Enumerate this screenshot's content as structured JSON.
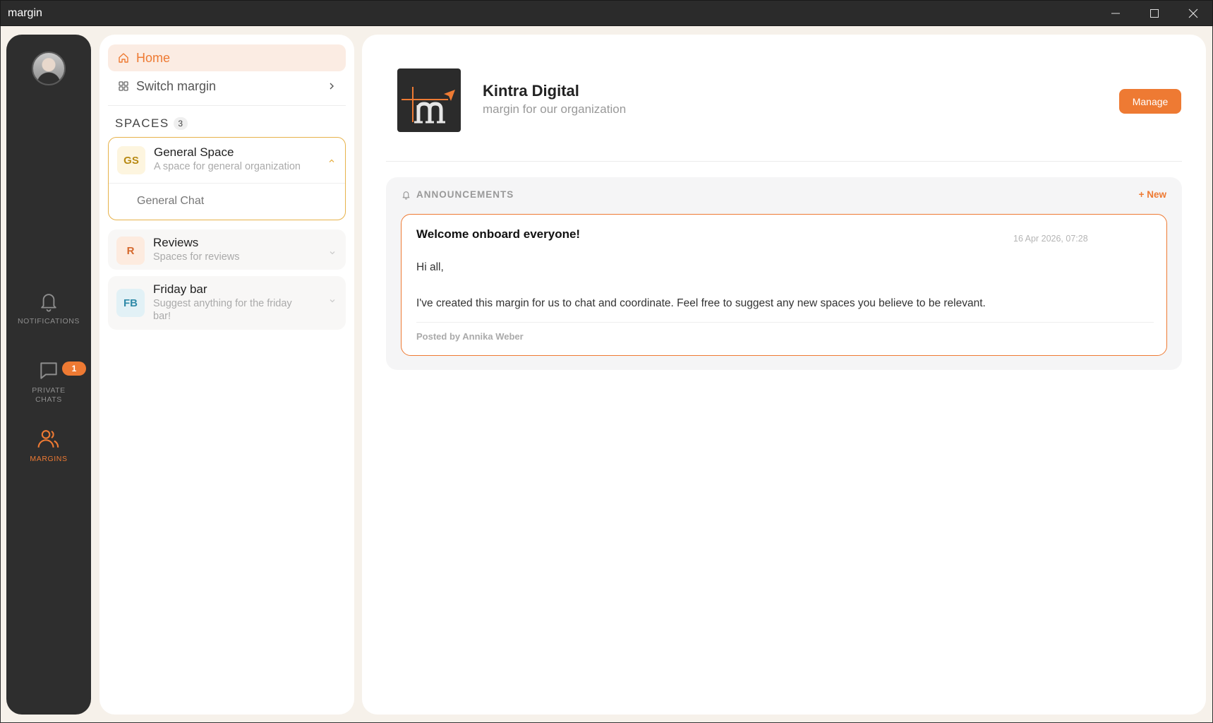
{
  "window": {
    "title": "margin"
  },
  "rail": {
    "items": [
      {
        "label": "NOTIFICATIONS",
        "icon": "bell-icon"
      },
      {
        "label": "PRIVATE CHATS",
        "icon": "chat-bubble-icon",
        "badge": "1"
      },
      {
        "label": "MARGINS",
        "icon": "users-icon",
        "active": true
      }
    ],
    "accent": "#ee7a33"
  },
  "sidebar": {
    "home_label": "Home",
    "switch_label": "Switch margin",
    "spaces_heading": "SPACES",
    "spaces_count": "3",
    "spaces": [
      {
        "initials": "GS",
        "name": "General Space",
        "description": "A space for general organization",
        "expanded": true,
        "avatar_bg": "#fdf5df",
        "avatar_fg": "#b88a14",
        "channels": [
          "General Chat"
        ]
      },
      {
        "initials": "R",
        "name": "Reviews",
        "description": "Spaces for reviews",
        "expanded": false,
        "avatar_bg": "#fdebdf",
        "avatar_fg": "#d5682c"
      },
      {
        "initials": "FB",
        "name": "Friday bar",
        "description": "Suggest anything for the friday bar!",
        "expanded": false,
        "avatar_bg": "#e2f1f6",
        "avatar_fg": "#2f8aa8"
      }
    ]
  },
  "main": {
    "org_name": "Kintra Digital",
    "org_description": "margin for our organization",
    "manage_label": "Manage",
    "announcements": {
      "heading": "ANNOUNCEMENTS",
      "new_label": "+ New",
      "items": [
        {
          "title": "Welcome onboard everyone!",
          "date": "16 Apr 2026, 07:28",
          "greeting": "Hi all,",
          "body": "I've created this margin for us to chat and coordinate. Feel free to suggest any new spaces you believe to be relevant.",
          "author": "Posted by Annika Weber"
        }
      ]
    }
  }
}
